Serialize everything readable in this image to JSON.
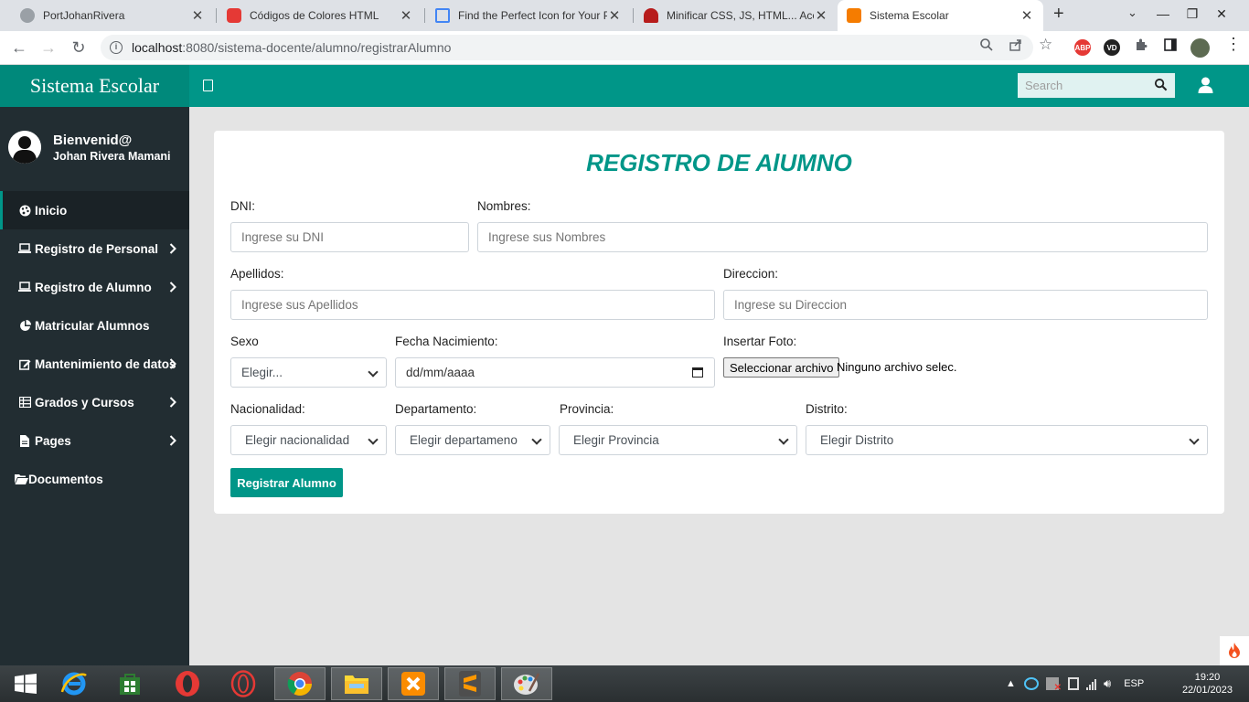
{
  "browser": {
    "tabs": [
      {
        "title": "PortJohanRivera",
        "color": "#5f6368"
      },
      {
        "title": "Códigos de Colores HTML",
        "color": "#e53935"
      },
      {
        "title": "Find the Perfect Icon for Your P",
        "color": "#4285f4"
      },
      {
        "title": "Minificar CSS, JS, HTML... Acele",
        "color": "#b71c1c"
      },
      {
        "title": "Sistema Escolar",
        "color": "#f57c00"
      }
    ],
    "url_host": "localhost",
    "url_rest": ":8080/sistema-docente/alumno/registrarAlumno",
    "ext_abp": "ABP",
    "ext_vd": "VD"
  },
  "app": {
    "brand": "Sistema Escolar",
    "search_placeholder": "Search",
    "colors": {
      "primary": "#009688",
      "sidebar": "#222d32",
      "brand_bg": "#00897b"
    }
  },
  "sidebar": {
    "welcome": "Bienvenid@",
    "user_name": "Johan Rivera Mamani",
    "items": [
      {
        "label": "Inicio",
        "icon": "palette-icon"
      },
      {
        "label": "Registro de Personal",
        "icon": "laptop-icon"
      },
      {
        "label": "Registro de Alumno",
        "icon": "laptop-icon"
      },
      {
        "label": "Matricular Alumnos",
        "icon": "pie-chart-icon"
      },
      {
        "label": "Mantenimiento de datos",
        "icon": "edit-icon"
      },
      {
        "label": "Grados y Cursos",
        "icon": "table-icon"
      },
      {
        "label": "Pages",
        "icon": "file-icon"
      },
      {
        "label": "Documentos",
        "icon": "folder-open-icon"
      }
    ]
  },
  "form": {
    "title": "REGISTRO DE AlUMNO",
    "dni_label": "DNI:",
    "dni_placeholder": "Ingrese su DNI",
    "nombres_label": "Nombres:",
    "nombres_placeholder": "Ingrese sus Nombres",
    "apellidos_label": "Apellidos:",
    "apellidos_placeholder": "Ingrese sus Apellidos",
    "direccion_label": "Direccion:",
    "direccion_placeholder": "Ingrese su Direccion",
    "sexo_label": "Sexo",
    "sexo_value": "Elegir...",
    "fecha_label": "Fecha Nacimiento:",
    "fecha_value": "dd/mm/aaaa",
    "foto_label": "Insertar Foto:",
    "foto_button": "Seleccionar archivo",
    "foto_status": "Ninguno archivo selec.",
    "nacionalidad_label": "Nacionalidad:",
    "nacionalidad_value": "Elegir nacionalidad",
    "departamento_label": "Departamento:",
    "departamento_value": "Elegir departameno",
    "provincia_label": "Provincia:",
    "provincia_value": "Elegir Provincia",
    "distrito_label": "Distrito:",
    "distrito_value": "Elegir Distrito",
    "submit_label": "Registrar Alumno"
  },
  "taskbar": {
    "language": "ESP",
    "time": "19:20",
    "date": "22/01/2023"
  }
}
